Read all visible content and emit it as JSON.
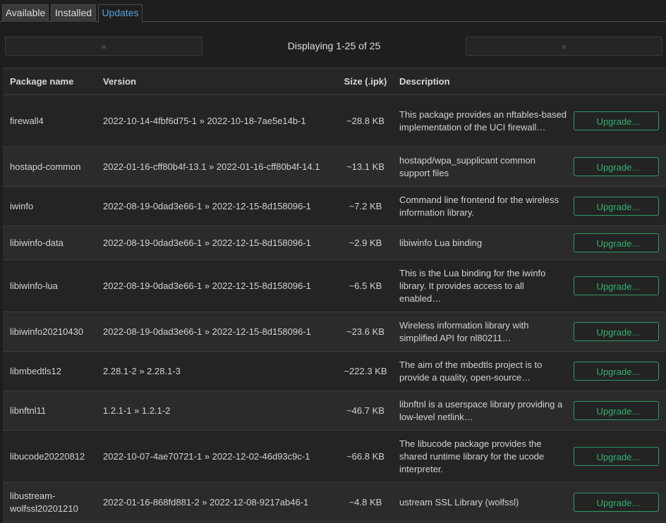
{
  "tabs": [
    {
      "label": "Available",
      "active": false
    },
    {
      "label": "Installed",
      "active": false
    },
    {
      "label": "Updates",
      "active": true
    }
  ],
  "pager": {
    "prev_label": "«",
    "next_label": "»",
    "status": "Displaying 1-25 of 25"
  },
  "table": {
    "headers": {
      "name": "Package name",
      "version": "Version",
      "size": "Size (.ipk)",
      "description": "Description"
    },
    "rows": [
      {
        "name": "firewall4",
        "version": "2022-10-14-4fbf6d75-1 » 2022-10-18-7ae5e14b-1",
        "size": "~28.8 KB",
        "description": "This package provides an nftables-based implementation of the UCI firewall…",
        "action": "Upgrade…"
      },
      {
        "name": "hostapd-common",
        "version": "2022-01-16-cff80b4f-13.1 » 2022-01-16-cff80b4f-14.1",
        "size": "~13.1 KB",
        "description": "hostapd/wpa_supplicant common support files",
        "action": "Upgrade…"
      },
      {
        "name": "iwinfo",
        "version": "2022-08-19-0dad3e66-1 » 2022-12-15-8d158096-1",
        "size": "~7.2 KB",
        "description": "Command line frontend for the wireless information library.",
        "action": "Upgrade…"
      },
      {
        "name": "libiwinfo-data",
        "version": "2022-08-19-0dad3e66-1 » 2022-12-15-8d158096-1",
        "size": "~2.9 KB",
        "description": "libiwinfo Lua binding",
        "action": "Upgrade…"
      },
      {
        "name": "libiwinfo-lua",
        "version": "2022-08-19-0dad3e66-1 » 2022-12-15-8d158096-1",
        "size": "~6.5 KB",
        "description": "This is the Lua binding for the iwinfo library. It provides access to all enabled…",
        "action": "Upgrade…"
      },
      {
        "name": "libiwinfo20210430",
        "version": "2022-08-19-0dad3e66-1 » 2022-12-15-8d158096-1",
        "size": "~23.6 KB",
        "description": "Wireless information library with simplified API for nl80211…",
        "action": "Upgrade…"
      },
      {
        "name": "libmbedtls12",
        "version": "2.28.1-2 » 2.28.1-3",
        "size": "~222.3 KB",
        "description": "The aim of the mbedtls project is to provide a quality, open-source…",
        "action": "Upgrade…"
      },
      {
        "name": "libnftnl11",
        "version": "1.2.1-1 » 1.2.1-2",
        "size": "~46.7 KB",
        "description": "libnftnl is a userspace library providing a low-level netlink…",
        "action": "Upgrade…"
      },
      {
        "name": "libucode20220812",
        "version": "2022-10-07-4ae70721-1 » 2022-12-02-46d93c9c-1",
        "size": "~66.8 KB",
        "description": "The libucode package provides the shared runtime library for the ucode interpreter.",
        "action": "Upgrade…"
      },
      {
        "name": "libustream-wolfssl20201210",
        "version": "2022-01-16-868fd881-2 » 2022-12-08-9217ab46-1",
        "size": "~4.8 KB",
        "description": "ustream SSL Library (wolfssl)",
        "action": "Upgrade…"
      }
    ]
  },
  "colors": {
    "accent_blue": "#5aa0d8",
    "upgrade_green": "#33b072"
  }
}
